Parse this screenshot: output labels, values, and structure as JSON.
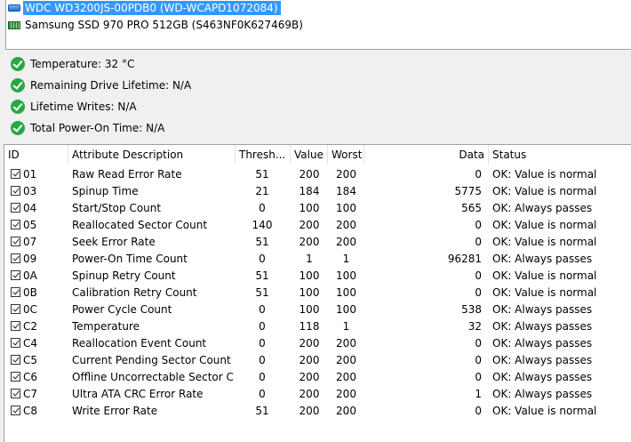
{
  "drives": [
    {
      "label": "WDC WD3200JS-00PDB0 (WD-WCAPD1072084)",
      "icon": "hdd-icon",
      "selected": true
    },
    {
      "label": "Samsung SSD 970 PRO 512GB (S463NF0K627469B)",
      "icon": "ssd-icon",
      "selected": false
    }
  ],
  "status": [
    {
      "label": "Temperature: 32 °C"
    },
    {
      "label": "Remaining Drive Lifetime: N/A"
    },
    {
      "label": "Lifetime Writes: N/A"
    },
    {
      "label": "Total Power-On Time: N/A"
    }
  ],
  "table": {
    "headers": [
      "ID",
      "Attribute Description",
      "Thresh...",
      "Value",
      "Worst",
      "Data",
      "Status"
    ],
    "rows": [
      {
        "id": "01",
        "desc": "Raw Read Error Rate",
        "thresh": "51",
        "value": "200",
        "worst": "200",
        "data": "0",
        "status": "OK: Value is normal"
      },
      {
        "id": "03",
        "desc": "Spinup Time",
        "thresh": "21",
        "value": "184",
        "worst": "184",
        "data": "5775",
        "status": "OK: Value is normal"
      },
      {
        "id": "04",
        "desc": "Start/Stop Count",
        "thresh": "0",
        "value": "100",
        "worst": "100",
        "data": "565",
        "status": "OK: Always passes"
      },
      {
        "id": "05",
        "desc": "Reallocated Sector Count",
        "thresh": "140",
        "value": "200",
        "worst": "200",
        "data": "0",
        "status": "OK: Value is normal"
      },
      {
        "id": "07",
        "desc": "Seek Error Rate",
        "thresh": "51",
        "value": "200",
        "worst": "200",
        "data": "0",
        "status": "OK: Value is normal"
      },
      {
        "id": "09",
        "desc": "Power-On Time Count",
        "thresh": "0",
        "value": "1",
        "worst": "1",
        "data": "96281",
        "status": "OK: Always passes"
      },
      {
        "id": "0A",
        "desc": "Spinup Retry Count",
        "thresh": "51",
        "value": "100",
        "worst": "100",
        "data": "0",
        "status": "OK: Value is normal"
      },
      {
        "id": "0B",
        "desc": "Calibration Retry Count",
        "thresh": "51",
        "value": "100",
        "worst": "100",
        "data": "0",
        "status": "OK: Value is normal"
      },
      {
        "id": "0C",
        "desc": "Power Cycle Count",
        "thresh": "0",
        "value": "100",
        "worst": "100",
        "data": "538",
        "status": "OK: Always passes"
      },
      {
        "id": "C2",
        "desc": "Temperature",
        "thresh": "0",
        "value": "118",
        "worst": "1",
        "data": "32",
        "status": "OK: Always passes"
      },
      {
        "id": "C4",
        "desc": "Reallocation Event Count",
        "thresh": "0",
        "value": "200",
        "worst": "200",
        "data": "0",
        "status": "OK: Always passes"
      },
      {
        "id": "C5",
        "desc": "Current Pending Sector Count",
        "thresh": "0",
        "value": "200",
        "worst": "200",
        "data": "0",
        "status": "OK: Always passes"
      },
      {
        "id": "C6",
        "desc": "Offline Uncorrectable Sector C...",
        "thresh": "0",
        "value": "200",
        "worst": "200",
        "data": "0",
        "status": "OK: Always passes"
      },
      {
        "id": "C7",
        "desc": "Ultra ATA CRC Error Rate",
        "thresh": "0",
        "value": "200",
        "worst": "200",
        "data": "1",
        "status": "OK: Always passes"
      },
      {
        "id": "C8",
        "desc": "Write Error Rate",
        "thresh": "51",
        "value": "200",
        "worst": "200",
        "data": "0",
        "status": "OK: Value is normal"
      }
    ]
  }
}
